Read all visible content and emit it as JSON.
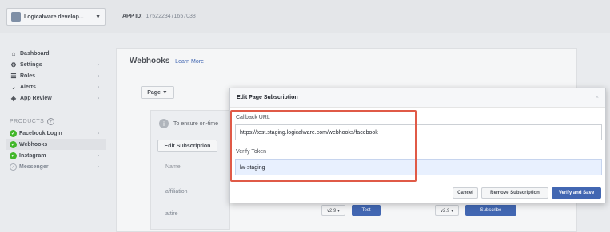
{
  "topbar": {
    "app_name": "Logicalware develop...",
    "app_caret": "▼",
    "app_id_label": "APP ID:",
    "app_id_value": "1752223471657038"
  },
  "sidebar": {
    "items": [
      {
        "label": "Dashboard",
        "icon": "home-icon",
        "glyph": "⌂"
      },
      {
        "label": "Settings",
        "icon": "gear-icon",
        "glyph": "⚙",
        "chevron": "›"
      },
      {
        "label": "Roles",
        "icon": "roles-icon",
        "glyph": "☰",
        "chevron": "›"
      },
      {
        "label": "Alerts",
        "icon": "bell-icon",
        "glyph": "♪",
        "chevron": "›"
      },
      {
        "label": "App Review",
        "icon": "shield-icon",
        "glyph": "◈",
        "chevron": "›"
      }
    ],
    "products_label": "PRODUCTS",
    "products_plus": "+",
    "products": [
      {
        "label": "Facebook Login",
        "status": "green",
        "chevron": "›"
      },
      {
        "label": "Webhooks",
        "status": "green",
        "active": true
      },
      {
        "label": "Instagram",
        "status": "green",
        "chevron": "›"
      },
      {
        "label": "Messenger",
        "status": "grey",
        "chevron": "›"
      }
    ]
  },
  "main": {
    "title": "Webhooks",
    "learn_more": "Learn More",
    "page_select": "Page ▼",
    "info_text": "To ensure on-time",
    "edit_subscription": "Edit Subscription",
    "column_header": "Name",
    "rows": [
      {
        "name": "affiliation"
      },
      {
        "name": "attire"
      }
    ],
    "version_label": "v2.9 ▾",
    "test_label": "Test",
    "subscribe_label": "Subscribe"
  },
  "modal": {
    "title": "Edit Page Subscription",
    "close": "×",
    "callback_label": "Callback URL",
    "callback_value": "https://test.staging.logicalware.com/webhooks/facebook",
    "verify_label": "Verify Token",
    "verify_value": "lw-staging",
    "cancel": "Cancel",
    "remove": "Remove Subscription",
    "verify_save": "Verify and Save"
  },
  "colors": {
    "brand_blue": "#4267b2",
    "status_green": "#42b72a",
    "highlight_red": "#e05a47"
  }
}
